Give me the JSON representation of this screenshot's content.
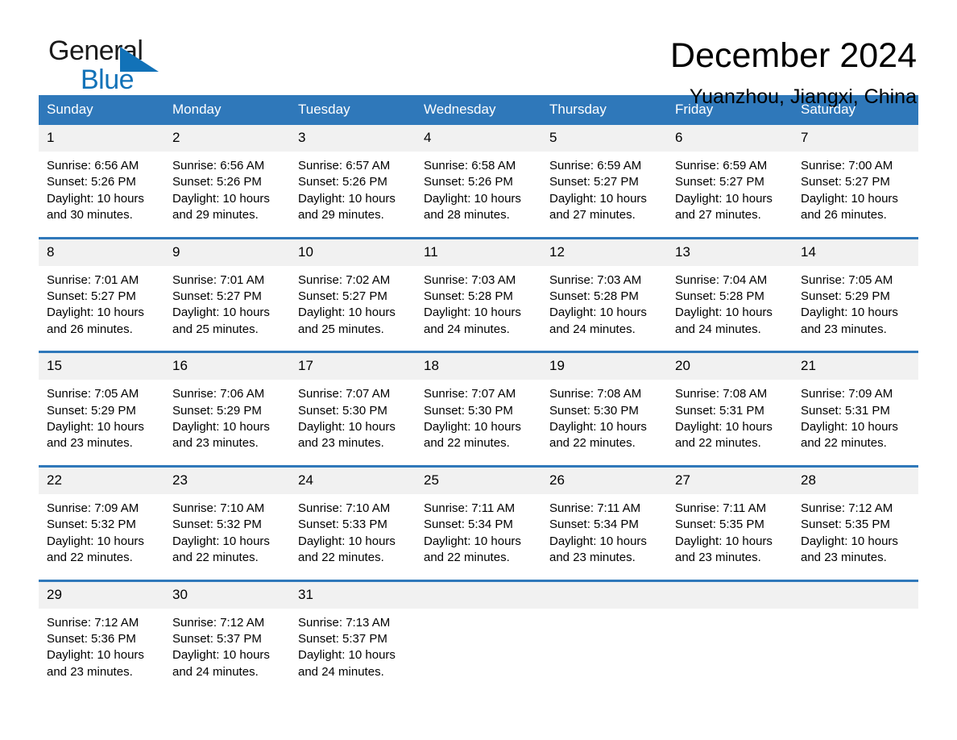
{
  "brand": {
    "line1": "General",
    "line2": "Blue",
    "flag_color": "#1272b8",
    "text_color": "#1a1a1a"
  },
  "header": {
    "month_title": "December 2024",
    "location": "Yuanzhou, Jiangxi, China"
  },
  "theme": {
    "header_blue": "#2f78ba",
    "daynum_gray": "#f1f1f1",
    "page_background": "#ffffff"
  },
  "calendar": {
    "weekday_headers": [
      "Sunday",
      "Monday",
      "Tuesday",
      "Wednesday",
      "Thursday",
      "Friday",
      "Saturday"
    ],
    "weeks": [
      [
        {
          "day": "1",
          "sunrise": "Sunrise: 6:56 AM",
          "sunset": "Sunset: 5:26 PM",
          "daylight_1": "Daylight: 10 hours",
          "daylight_2": "and 30 minutes."
        },
        {
          "day": "2",
          "sunrise": "Sunrise: 6:56 AM",
          "sunset": "Sunset: 5:26 PM",
          "daylight_1": "Daylight: 10 hours",
          "daylight_2": "and 29 minutes."
        },
        {
          "day": "3",
          "sunrise": "Sunrise: 6:57 AM",
          "sunset": "Sunset: 5:26 PM",
          "daylight_1": "Daylight: 10 hours",
          "daylight_2": "and 29 minutes."
        },
        {
          "day": "4",
          "sunrise": "Sunrise: 6:58 AM",
          "sunset": "Sunset: 5:26 PM",
          "daylight_1": "Daylight: 10 hours",
          "daylight_2": "and 28 minutes."
        },
        {
          "day": "5",
          "sunrise": "Sunrise: 6:59 AM",
          "sunset": "Sunset: 5:27 PM",
          "daylight_1": "Daylight: 10 hours",
          "daylight_2": "and 27 minutes."
        },
        {
          "day": "6",
          "sunrise": "Sunrise: 6:59 AM",
          "sunset": "Sunset: 5:27 PM",
          "daylight_1": "Daylight: 10 hours",
          "daylight_2": "and 27 minutes."
        },
        {
          "day": "7",
          "sunrise": "Sunrise: 7:00 AM",
          "sunset": "Sunset: 5:27 PM",
          "daylight_1": "Daylight: 10 hours",
          "daylight_2": "and 26 minutes."
        }
      ],
      [
        {
          "day": "8",
          "sunrise": "Sunrise: 7:01 AM",
          "sunset": "Sunset: 5:27 PM",
          "daylight_1": "Daylight: 10 hours",
          "daylight_2": "and 26 minutes."
        },
        {
          "day": "9",
          "sunrise": "Sunrise: 7:01 AM",
          "sunset": "Sunset: 5:27 PM",
          "daylight_1": "Daylight: 10 hours",
          "daylight_2": "and 25 minutes."
        },
        {
          "day": "10",
          "sunrise": "Sunrise: 7:02 AM",
          "sunset": "Sunset: 5:27 PM",
          "daylight_1": "Daylight: 10 hours",
          "daylight_2": "and 25 minutes."
        },
        {
          "day": "11",
          "sunrise": "Sunrise: 7:03 AM",
          "sunset": "Sunset: 5:28 PM",
          "daylight_1": "Daylight: 10 hours",
          "daylight_2": "and 24 minutes."
        },
        {
          "day": "12",
          "sunrise": "Sunrise: 7:03 AM",
          "sunset": "Sunset: 5:28 PM",
          "daylight_1": "Daylight: 10 hours",
          "daylight_2": "and 24 minutes."
        },
        {
          "day": "13",
          "sunrise": "Sunrise: 7:04 AM",
          "sunset": "Sunset: 5:28 PM",
          "daylight_1": "Daylight: 10 hours",
          "daylight_2": "and 24 minutes."
        },
        {
          "day": "14",
          "sunrise": "Sunrise: 7:05 AM",
          "sunset": "Sunset: 5:29 PM",
          "daylight_1": "Daylight: 10 hours",
          "daylight_2": "and 23 minutes."
        }
      ],
      [
        {
          "day": "15",
          "sunrise": "Sunrise: 7:05 AM",
          "sunset": "Sunset: 5:29 PM",
          "daylight_1": "Daylight: 10 hours",
          "daylight_2": "and 23 minutes."
        },
        {
          "day": "16",
          "sunrise": "Sunrise: 7:06 AM",
          "sunset": "Sunset: 5:29 PM",
          "daylight_1": "Daylight: 10 hours",
          "daylight_2": "and 23 minutes."
        },
        {
          "day": "17",
          "sunrise": "Sunrise: 7:07 AM",
          "sunset": "Sunset: 5:30 PM",
          "daylight_1": "Daylight: 10 hours",
          "daylight_2": "and 23 minutes."
        },
        {
          "day": "18",
          "sunrise": "Sunrise: 7:07 AM",
          "sunset": "Sunset: 5:30 PM",
          "daylight_1": "Daylight: 10 hours",
          "daylight_2": "and 22 minutes."
        },
        {
          "day": "19",
          "sunrise": "Sunrise: 7:08 AM",
          "sunset": "Sunset: 5:30 PM",
          "daylight_1": "Daylight: 10 hours",
          "daylight_2": "and 22 minutes."
        },
        {
          "day": "20",
          "sunrise": "Sunrise: 7:08 AM",
          "sunset": "Sunset: 5:31 PM",
          "daylight_1": "Daylight: 10 hours",
          "daylight_2": "and 22 minutes."
        },
        {
          "day": "21",
          "sunrise": "Sunrise: 7:09 AM",
          "sunset": "Sunset: 5:31 PM",
          "daylight_1": "Daylight: 10 hours",
          "daylight_2": "and 22 minutes."
        }
      ],
      [
        {
          "day": "22",
          "sunrise": "Sunrise: 7:09 AM",
          "sunset": "Sunset: 5:32 PM",
          "daylight_1": "Daylight: 10 hours",
          "daylight_2": "and 22 minutes."
        },
        {
          "day": "23",
          "sunrise": "Sunrise: 7:10 AM",
          "sunset": "Sunset: 5:32 PM",
          "daylight_1": "Daylight: 10 hours",
          "daylight_2": "and 22 minutes."
        },
        {
          "day": "24",
          "sunrise": "Sunrise: 7:10 AM",
          "sunset": "Sunset: 5:33 PM",
          "daylight_1": "Daylight: 10 hours",
          "daylight_2": "and 22 minutes."
        },
        {
          "day": "25",
          "sunrise": "Sunrise: 7:11 AM",
          "sunset": "Sunset: 5:34 PM",
          "daylight_1": "Daylight: 10 hours",
          "daylight_2": "and 22 minutes."
        },
        {
          "day": "26",
          "sunrise": "Sunrise: 7:11 AM",
          "sunset": "Sunset: 5:34 PM",
          "daylight_1": "Daylight: 10 hours",
          "daylight_2": "and 23 minutes."
        },
        {
          "day": "27",
          "sunrise": "Sunrise: 7:11 AM",
          "sunset": "Sunset: 5:35 PM",
          "daylight_1": "Daylight: 10 hours",
          "daylight_2": "and 23 minutes."
        },
        {
          "day": "28",
          "sunrise": "Sunrise: 7:12 AM",
          "sunset": "Sunset: 5:35 PM",
          "daylight_1": "Daylight: 10 hours",
          "daylight_2": "and 23 minutes."
        }
      ],
      [
        {
          "day": "29",
          "sunrise": "Sunrise: 7:12 AM",
          "sunset": "Sunset: 5:36 PM",
          "daylight_1": "Daylight: 10 hours",
          "daylight_2": "and 23 minutes."
        },
        {
          "day": "30",
          "sunrise": "Sunrise: 7:12 AM",
          "sunset": "Sunset: 5:37 PM",
          "daylight_1": "Daylight: 10 hours",
          "daylight_2": "and 24 minutes."
        },
        {
          "day": "31",
          "sunrise": "Sunrise: 7:13 AM",
          "sunset": "Sunset: 5:37 PM",
          "daylight_1": "Daylight: 10 hours",
          "daylight_2": "and 24 minutes."
        },
        {
          "day": "",
          "sunrise": "",
          "sunset": "",
          "daylight_1": "",
          "daylight_2": ""
        },
        {
          "day": "",
          "sunrise": "",
          "sunset": "",
          "daylight_1": "",
          "daylight_2": ""
        },
        {
          "day": "",
          "sunrise": "",
          "sunset": "",
          "daylight_1": "",
          "daylight_2": ""
        },
        {
          "day": "",
          "sunrise": "",
          "sunset": "",
          "daylight_1": "",
          "daylight_2": ""
        }
      ]
    ]
  }
}
